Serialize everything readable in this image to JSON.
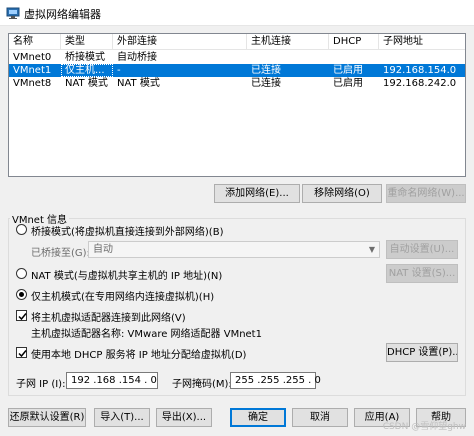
{
  "window": {
    "title": "虚拟网络编辑器",
    "accent": "#0078d7"
  },
  "networks": {
    "headers": {
      "name": "名称",
      "type": "类型",
      "external": "外部连接",
      "host": "主机连接",
      "dhcp": "DHCP",
      "subnet": "子网地址"
    },
    "rows": [
      {
        "name": "VMnet0",
        "type": "桥接模式",
        "external": "自动桥接",
        "host": "",
        "dhcp": "",
        "subnet": ""
      },
      {
        "name": "VMnet1",
        "type": "仅主机...",
        "external": "-",
        "host": "已连接",
        "dhcp": "已启用",
        "subnet": "192.168.154.0"
      },
      {
        "name": "VMnet8",
        "type": "NAT 模式",
        "external": "NAT 模式",
        "host": "已连接",
        "dhcp": "已启用",
        "subnet": "192.168.242.0"
      }
    ],
    "selected_row": 1
  },
  "list_buttons": {
    "add": "添加网络(E)...",
    "remove": "移除网络(O)",
    "rename": "重命名网络(W)..."
  },
  "vmnet_info": {
    "title": "VMnet 信息",
    "bridged": {
      "label": "桥接模式(将虚拟机直接连接到外部网络)(B)",
      "bridged_to_label": "已桥接至(G):",
      "bridged_to_value": "自动",
      "auto_settings": "自动设置(U)...",
      "checked": false
    },
    "nat": {
      "label": "NAT 模式(与虚拟机共享主机的 IP 地址)(N)",
      "settings": "NAT 设置(S)...",
      "checked": false
    },
    "host_only": {
      "label": "仅主机模式(在专用网络内连接虚拟机)(H)",
      "checked": true
    },
    "connect_adapter": {
      "label": "将主机虚拟适配器连接到此网络(V)",
      "adapter_name_label": "主机虚拟适配器名称: VMware 网络适配器 VMnet1",
      "checked": true
    },
    "dhcp": {
      "label": "使用本地 DHCP 服务将 IP 地址分配给虚拟机(D)",
      "settings": "DHCP 设置(P)...",
      "checked": true
    },
    "subnet_ip_label": "子网 IP (I):",
    "subnet_ip": "192 .168 .154 . 0",
    "subnet_mask_label": "子网掩码(M):",
    "subnet_mask": "255 .255 .255 . 0"
  },
  "footer": {
    "restore": "还原默认设置(R)",
    "import": "导入(T)...",
    "export": "导出(X)...",
    "ok": "确定",
    "cancel": "取消",
    "apply": "应用(A)",
    "help": "帮助"
  },
  "watermark": "CSDN @雪仰望ghw"
}
